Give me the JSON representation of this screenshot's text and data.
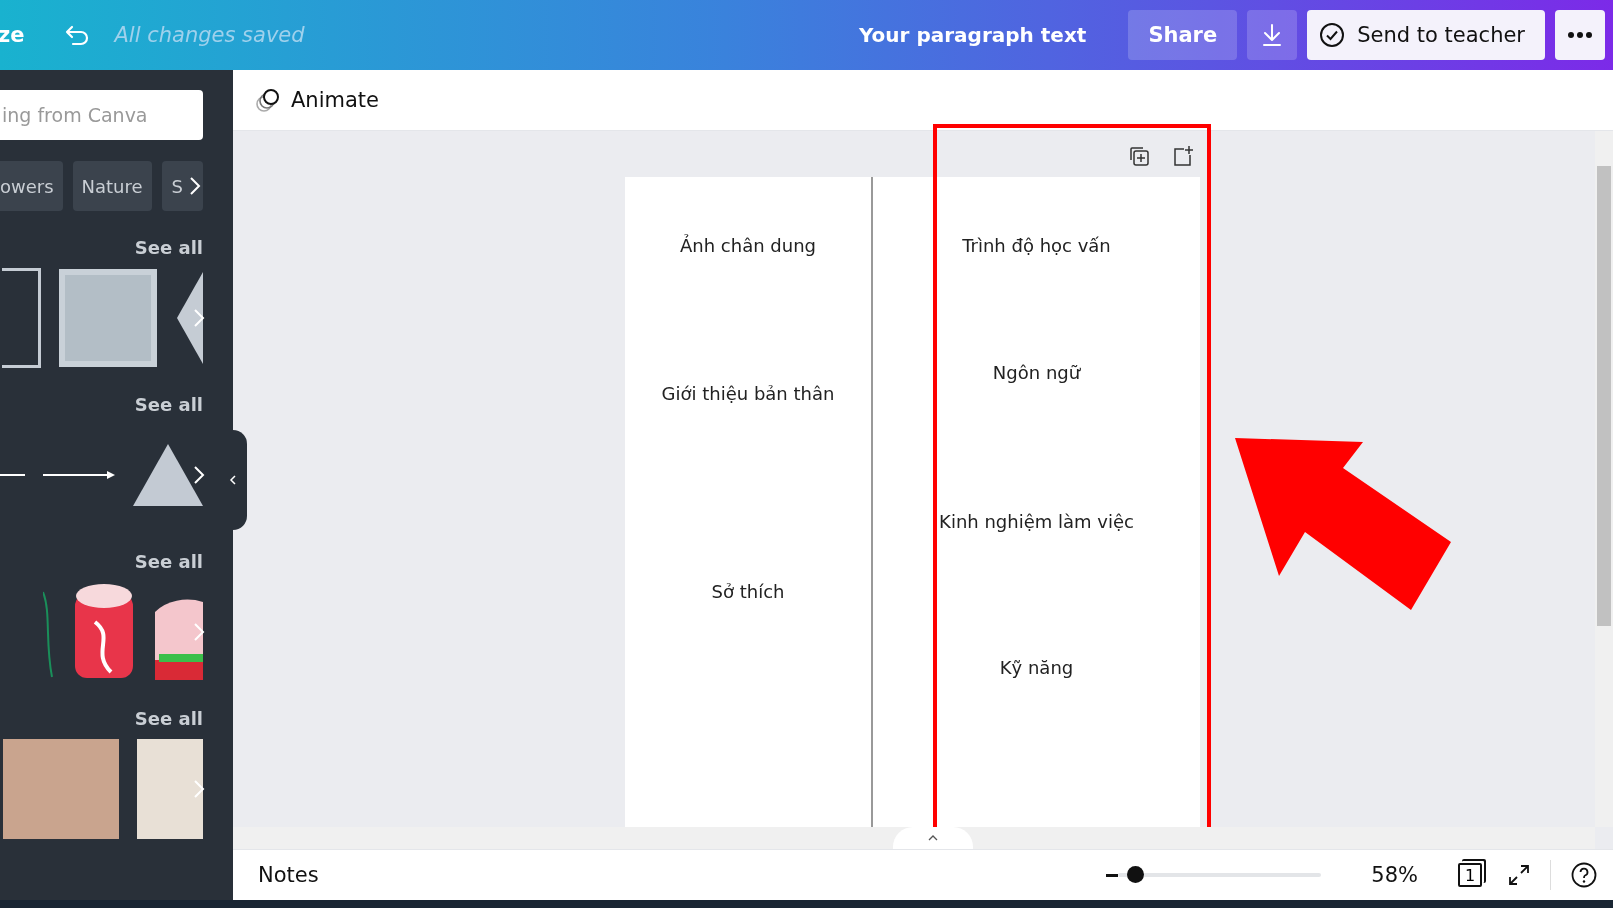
{
  "top_bar": {
    "title_fragment": "ze",
    "save_status": "All changes saved",
    "document_title": "Your paragraph text",
    "share_button": "Share",
    "send_button": "Send to teacher"
  },
  "sidebar": {
    "search": {
      "placeholder": "ing from Canva"
    },
    "tags": [
      "owers",
      "Nature",
      "S"
    ],
    "sections": [
      {
        "kind": "shapes",
        "see_all": "See all"
      },
      {
        "kind": "lines",
        "see_all": "See all"
      },
      {
        "kind": "stickers",
        "see_all": "See all"
      },
      {
        "kind": "photos",
        "see_all": "See all"
      }
    ]
  },
  "toolbar": {
    "animate": "Animate"
  },
  "page": {
    "left_column": [
      "Ảnh chân dung",
      "Giới thiệu bản thân",
      "Sở thích"
    ],
    "right_column": [
      "Trình độ học vấn",
      "Ngôn ngữ",
      "Kinh nghiệm làm việc",
      "Kỹ năng"
    ]
  },
  "bottom_bar": {
    "notes": "Notes",
    "zoom": {
      "level": 0.08
    },
    "zoom_reading": "58%",
    "page_count": "1"
  }
}
